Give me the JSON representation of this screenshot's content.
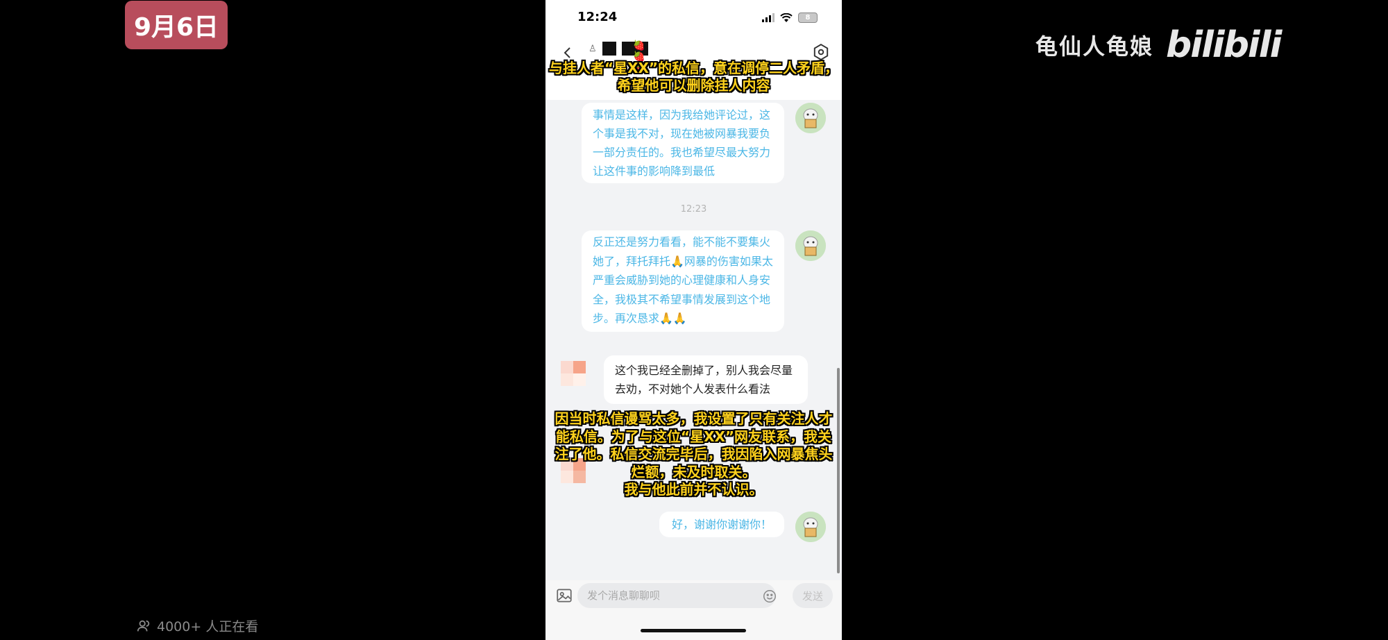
{
  "overlay": {
    "date_badge": "9月6日",
    "watermark_text": "龟仙人龟娘",
    "watermark_logo": "bilibili",
    "viewers": "4000+ 人正在看"
  },
  "status_bar": {
    "time": "12:24",
    "battery": "8"
  },
  "header": {
    "name_emoji": "🍓🍓🍓"
  },
  "captions": {
    "top": "与挂人者“星XX”的私信，意在调停二人矛盾，希望他可以删除挂人内容",
    "middle": "因当时私信谩骂太多，我设置了只有关注人才能私信。为了与这位“星XX”网友联系，我关注了他。私信交流完毕后，我因陷入网暴焦头烂额，未及时取关。\n我与他此前并不认识。"
  },
  "messages": [
    {
      "side": "mine",
      "text": "事情是这样，因为我给她评论过，这个事是我不对，现在她被网暴我要负一部分责任的。我也希望尽最大努力让这件事的影响降到最低"
    },
    {
      "side": "mine",
      "text": "反正还是努力看看，能不能不要集火她了，拜托拜托🙏网暴的伤害如果太严重会威胁到她的心理健康和人身安全，我极其不希望事情发展到这个地步。再次恳求🙏🙏"
    },
    {
      "side": "theirs",
      "text": "这个我已经全删掉了，别人我会尽量去劝，不对她个人发表什么看法"
    },
    {
      "side": "mine",
      "text": "好，谢谢你谢谢你！"
    }
  ],
  "timestamp": "12:23",
  "input": {
    "placeholder": "发个消息聊聊呗",
    "send_label": "发送"
  },
  "colors": {
    "badge": "#b84d5c",
    "my_text": "#4cb7e6",
    "caption": "#ffd21c"
  }
}
